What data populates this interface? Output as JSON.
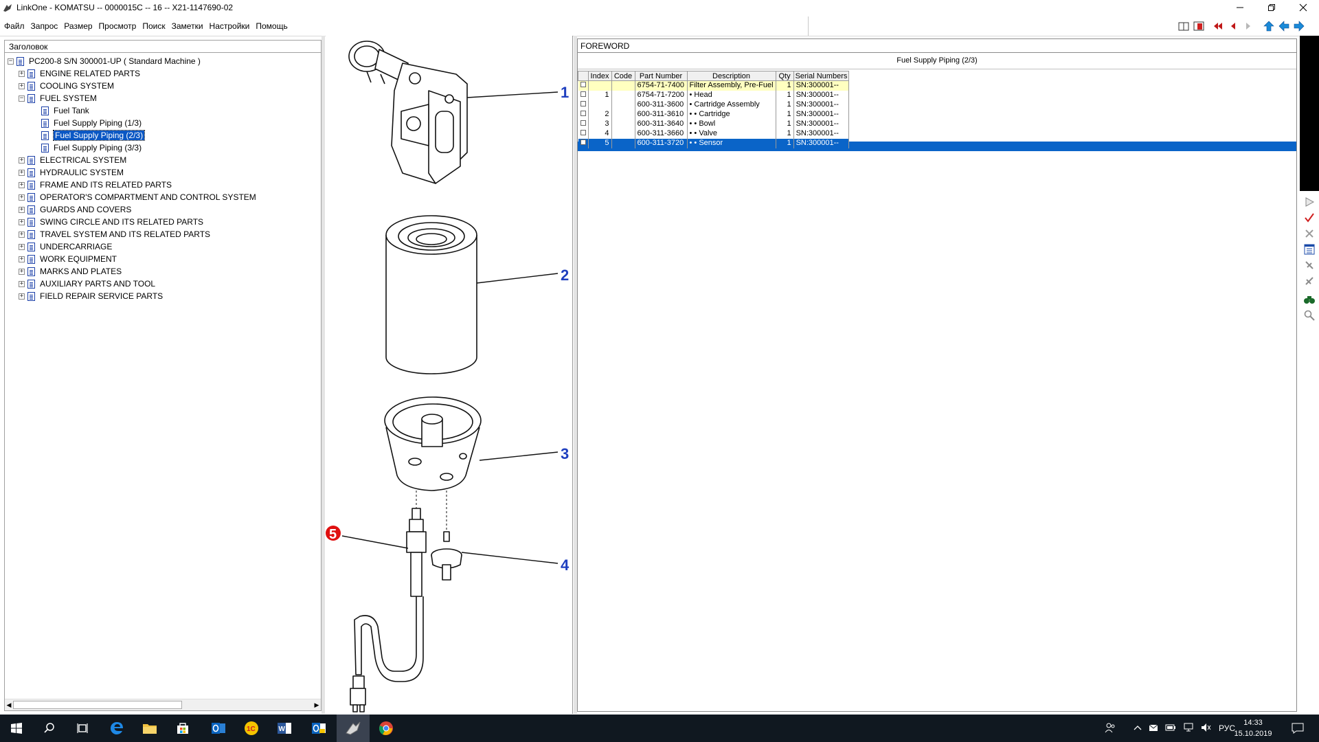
{
  "window": {
    "title": "LinkOne - KOMATSU -- 0000015C -- 16 -- X21-1147690-02",
    "controls": [
      "minimize",
      "restore",
      "close"
    ]
  },
  "menu": [
    "Файл",
    "Запрос",
    "Размер",
    "Просмотр",
    "Поиск",
    "Заметки",
    "Настройки",
    "Помощь"
  ],
  "toolbar": {
    "icons": [
      "book-icon",
      "book-red-icon",
      "first-page-icon",
      "prev-page-icon",
      "next-page-icon",
      "up-arrow-icon",
      "back-arrow-icon",
      "forward-arrow-icon"
    ]
  },
  "tree": {
    "header": "Заголовок",
    "root": "PC200-8 S/N 300001-UP ( Standard Machine )",
    "items": [
      {
        "label": "ENGINE RELATED PARTS",
        "level": 1,
        "expander": "+"
      },
      {
        "label": "COOLING SYSTEM",
        "level": 1,
        "expander": "+"
      },
      {
        "label": "FUEL SYSTEM",
        "level": 1,
        "expander": "-"
      },
      {
        "label": "Fuel Tank",
        "level": 2,
        "expander": ""
      },
      {
        "label": "Fuel Supply Piping (1/3)",
        "level": 2,
        "expander": ""
      },
      {
        "label": "Fuel Supply Piping (2/3)",
        "level": 2,
        "expander": "",
        "selected": true
      },
      {
        "label": "Fuel Supply Piping (3/3)",
        "level": 2,
        "expander": ""
      },
      {
        "label": "ELECTRICAL SYSTEM",
        "level": 1,
        "expander": "+"
      },
      {
        "label": "HYDRAULIC SYSTEM",
        "level": 1,
        "expander": "+"
      },
      {
        "label": "FRAME AND ITS RELATED PARTS",
        "level": 1,
        "expander": "+"
      },
      {
        "label": "OPERATOR'S COMPARTMENT AND CONTROL SYSTEM",
        "level": 1,
        "expander": "+"
      },
      {
        "label": "GUARDS AND COVERS",
        "level": 1,
        "expander": "+"
      },
      {
        "label": "SWING CIRCLE AND ITS RELATED PARTS",
        "level": 1,
        "expander": "+"
      },
      {
        "label": "TRAVEL SYSTEM AND ITS RELATED PARTS",
        "level": 1,
        "expander": "+"
      },
      {
        "label": "UNDERCARRIAGE",
        "level": 1,
        "expander": "+"
      },
      {
        "label": "WORK EQUIPMENT",
        "level": 1,
        "expander": "+"
      },
      {
        "label": "MARKS AND PLATES",
        "level": 1,
        "expander": "+"
      },
      {
        "label": "AUXILIARY PARTS AND TOOL",
        "level": 1,
        "expander": "+"
      },
      {
        "label": "FIELD REPAIR SERVICE PARTS",
        "level": 1,
        "expander": "+"
      }
    ]
  },
  "drawing": {
    "callouts": [
      "1",
      "2",
      "3",
      "4",
      "5"
    ],
    "highlighted_callout": "5"
  },
  "parts": {
    "foreword": "FOREWORD",
    "caption": "Fuel Supply Piping (2/3)",
    "columns": [
      "Index",
      "Code",
      "Part Number",
      "Description",
      "Qty",
      "Serial Numbers"
    ],
    "rows": [
      {
        "index": "",
        "code": "",
        "part": "6754-71-7400",
        "desc": "Filter Assembly, Pre-Fuel",
        "qty": "1",
        "serial": "SN:300001--",
        "state": "yellow"
      },
      {
        "index": "1",
        "code": "",
        "part": "6754-71-7200",
        "desc": "•  Head",
        "qty": "1",
        "serial": "SN:300001--",
        "state": ""
      },
      {
        "index": "",
        "code": "",
        "part": "600-311-3600",
        "desc": "•  Cartridge Assembly",
        "qty": "1",
        "serial": "SN:300001--",
        "state": ""
      },
      {
        "index": "2",
        "code": "",
        "part": "600-311-3610",
        "desc": "•  •  Cartridge",
        "qty": "1",
        "serial": "SN:300001--",
        "state": ""
      },
      {
        "index": "3",
        "code": "",
        "part": "600-311-3640",
        "desc": "•  •  Bowl",
        "qty": "1",
        "serial": "SN:300001--",
        "state": ""
      },
      {
        "index": "4",
        "code": "",
        "part": "600-311-3660",
        "desc": "•  •  Valve",
        "qty": "1",
        "serial": "SN:300001--",
        "state": ""
      },
      {
        "index": "5",
        "code": "",
        "part": "600-311-3720",
        "desc": "•  •  Sensor",
        "qty": "1",
        "serial": "SN:300001--",
        "state": "selected"
      }
    ]
  },
  "sidebar": {
    "icons": [
      "play-icon",
      "check-icon",
      "cross-icon",
      "list-icon",
      "attach-icon",
      "detach-icon",
      "binoculars-icon",
      "magnifier-icon"
    ]
  },
  "taskbar": {
    "apps": [
      "start-icon",
      "search-icon",
      "task-view-icon",
      "edge-icon",
      "explorer-icon",
      "store-icon",
      "outlook-icon",
      "1c-icon",
      "word-icon",
      "outlook2-icon",
      "linkone-icon",
      "chrome-icon"
    ],
    "lang": "РУС",
    "time": "14:33",
    "date": "15.10.2019"
  },
  "colors": {
    "selection": "#0a64c8",
    "tree_selection": "#0a57c4",
    "highlight_row": "#ffffc0",
    "callout_blue": "#1f3fbf",
    "callout_red": "#e01010",
    "taskbar": "#101820"
  }
}
